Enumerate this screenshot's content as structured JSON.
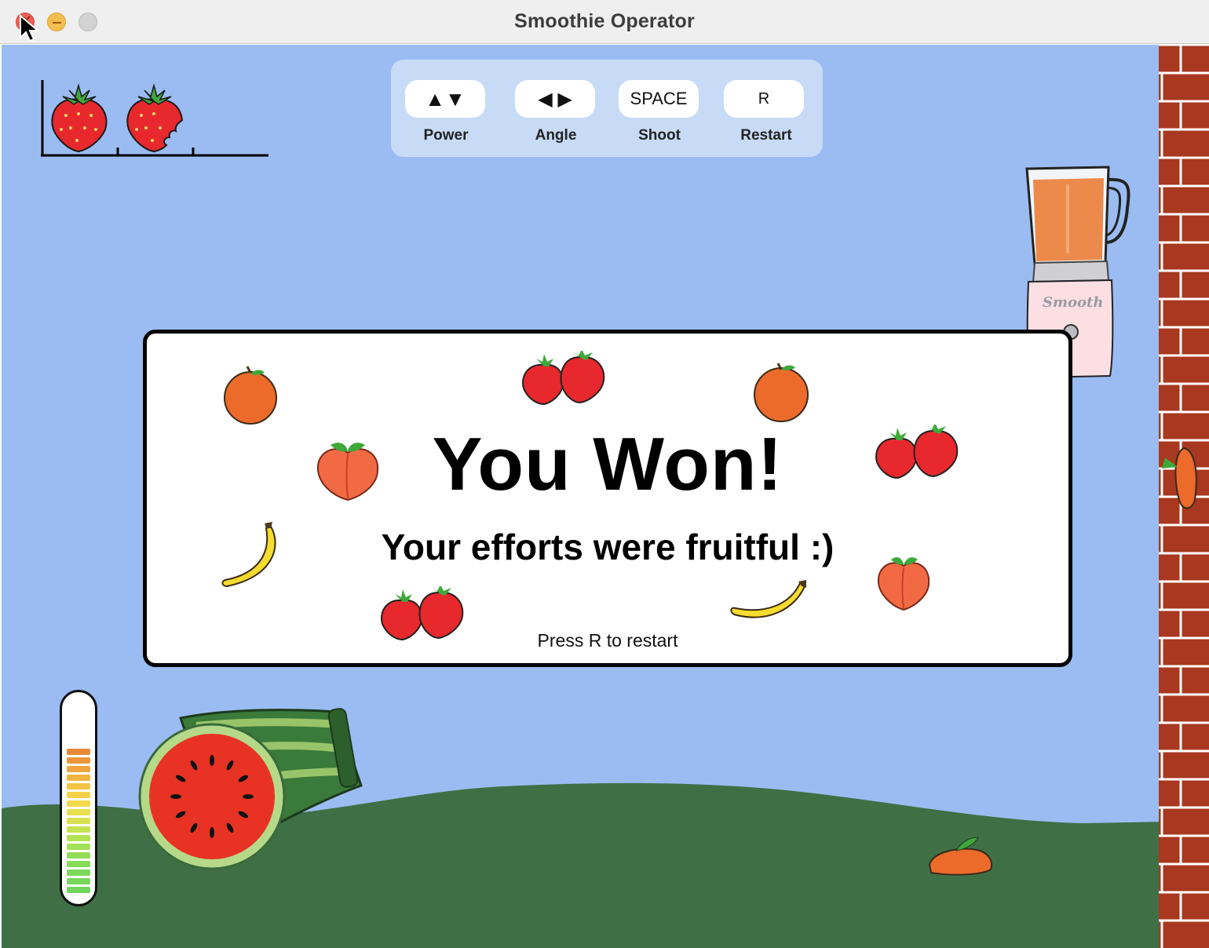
{
  "window": {
    "title": "Smoothie Operator"
  },
  "controls": [
    {
      "key": "▲▼",
      "label": "Power"
    },
    {
      "key": "◀ ▶",
      "label": "Angle"
    },
    {
      "key": "SPACE",
      "label": "Shoot"
    },
    {
      "key": "R",
      "label": "Restart"
    }
  ],
  "lives": {
    "remaining": 1.5,
    "max": 3
  },
  "blender": {
    "brand": "Smooth"
  },
  "dialog": {
    "title": "You Won!",
    "subtitle": "Your efforts were fruitful :)",
    "hint": "Press R to restart"
  },
  "power_meter": {
    "level_bars": 17,
    "max_bars": 17
  },
  "colors": {
    "sky": "#9bbcf2",
    "ground": "#3f7045",
    "brick": "#a8381f",
    "panel": "#c8dbf6"
  }
}
